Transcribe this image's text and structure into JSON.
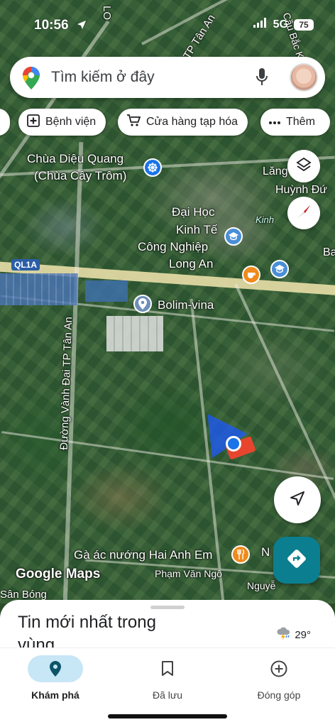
{
  "status_bar": {
    "time": "10:56",
    "network": "5G",
    "battery": "75"
  },
  "search": {
    "placeholder": "Tìm kiếm ở đây"
  },
  "chips": [
    {
      "label": "Bệnh viện",
      "icon": "hospital-icon"
    },
    {
      "label": "Cửa hàng tạp hóa",
      "icon": "cart-icon"
    },
    {
      "label": "Thêm",
      "icon": "more-icon"
    }
  ],
  "map": {
    "labels": {
      "pagoda_1": "Chùa Diệu Quang",
      "pagoda_2": "(Chùa Cây Trôm)",
      "university_1": "Đại Học",
      "university_2": "Kinh Tế",
      "university_3": "Công Nghiệp",
      "university_4": "Long An",
      "company": "Bolim-vina",
      "restaurant": "Gà ác nướng Hai Anh Em",
      "street": "Phạm Văn Ngô",
      "highway": "QL1A",
      "ring_road": "Đường Vành Đai TP Tân An",
      "ring_road_top": "Vành Đai TP Tân An",
      "kinh": "Kinh",
      "lang": "Lăng",
      "huynh": "Huỳnh Đứ",
      "ba": "Ba",
      "ng_right": "N",
      "nguy": "Nguyễ",
      "san_bong": "Sân Bóng",
      "top_lo": "LO",
      "top_cau": "Cầu Bắc K",
      "attribution": "Google Maps"
    }
  },
  "sheet": {
    "title": "Tin mới nhất trong vùng",
    "weather_temp": "29°"
  },
  "bottom_nav": [
    {
      "label": "Khám phá",
      "icon": "explore-pin-icon",
      "active": true
    },
    {
      "label": "Đã lưu",
      "icon": "bookmark-icon",
      "active": false
    },
    {
      "label": "Đóng góp",
      "icon": "add-circle-icon",
      "active": false
    }
  ],
  "colors": {
    "accent_blue": "#1a73e8",
    "directions_teal": "#0b7e8f",
    "road_yellow": "#e9dfa9",
    "location_red": "#e8452f"
  }
}
